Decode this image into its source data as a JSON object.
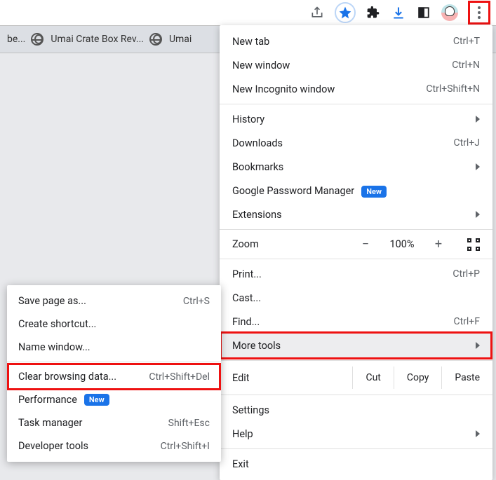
{
  "toolbar": {
    "icons": {
      "share": "share-icon",
      "star": "star-icon",
      "extensions": "puzzle-icon",
      "downloads": "download-icon",
      "sidepanel": "sidepanel-icon",
      "profile": "avatar-icon",
      "menu": "kebab-menu-icon"
    }
  },
  "bookmarks_bar": {
    "items": [
      {
        "label": "be..."
      },
      {
        "label": "Umai Crate Box Rev..."
      },
      {
        "label": "Umai"
      }
    ]
  },
  "main_menu": {
    "new_tab": {
      "label": "New tab",
      "shortcut": "Ctrl+T"
    },
    "new_window": {
      "label": "New window",
      "shortcut": "Ctrl+N"
    },
    "new_incognito": {
      "label": "New Incognito window",
      "shortcut": "Ctrl+Shift+N"
    },
    "history": {
      "label": "History"
    },
    "downloads": {
      "label": "Downloads",
      "shortcut": "Ctrl+J"
    },
    "bookmarks": {
      "label": "Bookmarks"
    },
    "password_manager": {
      "label": "Google Password Manager",
      "badge": "New"
    },
    "extensions": {
      "label": "Extensions"
    },
    "zoom": {
      "label": "Zoom",
      "minus": "−",
      "value": "100%",
      "plus": "+"
    },
    "print": {
      "label": "Print...",
      "shortcut": "Ctrl+P"
    },
    "cast": {
      "label": "Cast..."
    },
    "find": {
      "label": "Find...",
      "shortcut": "Ctrl+F"
    },
    "more_tools": {
      "label": "More tools"
    },
    "edit": {
      "label": "Edit",
      "cut": "Cut",
      "copy": "Copy",
      "paste": "Paste"
    },
    "settings": {
      "label": "Settings"
    },
    "help": {
      "label": "Help"
    },
    "exit": {
      "label": "Exit"
    }
  },
  "submenu": {
    "save_page": {
      "label": "Save page as...",
      "shortcut": "Ctrl+S"
    },
    "create_shortcut": {
      "label": "Create shortcut..."
    },
    "name_window": {
      "label": "Name window..."
    },
    "clear_data": {
      "label": "Clear browsing data...",
      "shortcut": "Ctrl+Shift+Del"
    },
    "performance": {
      "label": "Performance",
      "badge": "New"
    },
    "task_manager": {
      "label": "Task manager",
      "shortcut": "Shift+Esc"
    },
    "dev_tools": {
      "label": "Developer tools",
      "shortcut": "Ctrl+Shift+I"
    }
  },
  "colors": {
    "highlight": "#e11",
    "accent": "#1a73e8"
  }
}
